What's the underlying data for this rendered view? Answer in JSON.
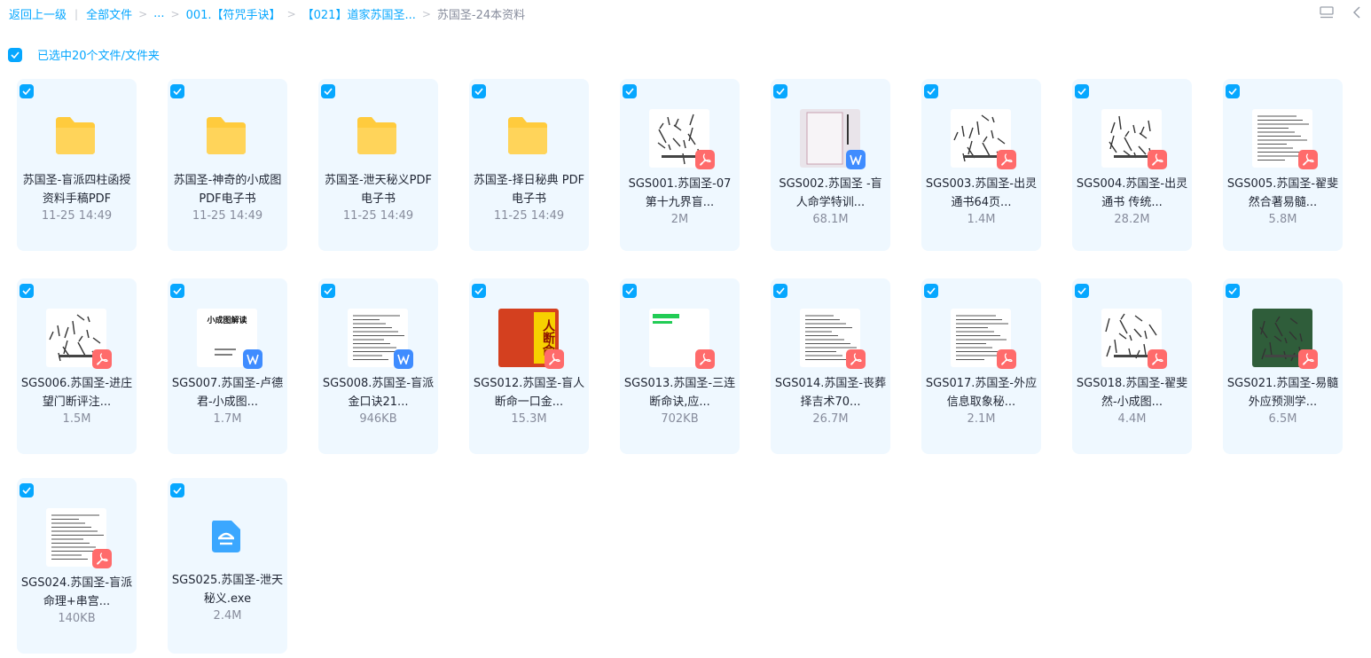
{
  "breadcrumb": {
    "back": "返回上一级",
    "items": [
      "全部文件",
      "...",
      "001.【符咒手诀】",
      "【021】道家苏国圣...",
      "苏国圣-24本资料"
    ]
  },
  "selection": {
    "label": "已选中20个文件/文件夹"
  },
  "icons": {
    "top_right": [
      "list-view-icon",
      "collapse-chevron-icon"
    ]
  },
  "files": [
    {
      "type": "folder",
      "name": "苏国圣-盲派四柱函授资料手稿PDF",
      "meta": "11-25 14:49"
    },
    {
      "type": "folder",
      "name": "苏国圣-神奇的小成图 PDF电子书",
      "meta": "11-25 14:49"
    },
    {
      "type": "folder",
      "name": "苏国圣-泄天秘义PDF电子书",
      "meta": "11-25 14:49"
    },
    {
      "type": "folder",
      "name": "苏国圣-择日秘典 PDF电子书",
      "meta": "11-25 14:49"
    },
    {
      "type": "pdf",
      "name": "SGS001.苏国圣-07第十九界盲...",
      "meta": "2M"
    },
    {
      "type": "word",
      "name": "SGS002.苏国圣 -盲人命学特训...",
      "meta": "68.1M"
    },
    {
      "type": "pdf",
      "name": "SGS003.苏国圣-出灵通书64页...",
      "meta": "1.4M"
    },
    {
      "type": "pdf",
      "name": "SGS004.苏国圣-出灵通书 传统...",
      "meta": "28.2M"
    },
    {
      "type": "pdf",
      "name": "SGS005.苏国圣-翟斐然合著易髓...",
      "meta": "5.8M"
    },
    {
      "type": "pdf",
      "name": "SGS006.苏国圣-进庄望门断评注...",
      "meta": "1.5M"
    },
    {
      "type": "word",
      "name": "SGS007.苏国圣-卢德君-小成图...",
      "meta": "1.7M",
      "thumb_text": "小成图解读"
    },
    {
      "type": "word",
      "name": "SGS008.苏国圣-盲派金口诀21...",
      "meta": "946KB"
    },
    {
      "type": "pdf",
      "name": "SGS012.苏国圣-盲人断命一口金...",
      "meta": "15.3M",
      "thumb_text": "人断命"
    },
    {
      "type": "pdf",
      "name": "SGS013.苏国圣-三连断命诀,应...",
      "meta": "702KB"
    },
    {
      "type": "pdf",
      "name": "SGS014.苏国圣-丧葬择吉术70...",
      "meta": "26.7M"
    },
    {
      "type": "pdf",
      "name": "SGS017.苏国圣-外应信息取象秘...",
      "meta": "2.1M"
    },
    {
      "type": "pdf",
      "name": "SGS018.苏国圣-翟斐然-小成图...",
      "meta": "4.4M"
    },
    {
      "type": "pdf",
      "name": "SGS021.苏国圣-易髓外应预测学...",
      "meta": "6.5M"
    },
    {
      "type": "pdf",
      "name": "SGS024.苏国圣-盲派命理+串宫...",
      "meta": "140KB"
    },
    {
      "type": "exe",
      "name": "SGS025.苏国圣-泄天秘义.exe",
      "meta": "2.4M"
    }
  ],
  "colors": {
    "accent": "#06a7ff",
    "card_bg": "#eff8ff",
    "pdf_badge": "#ff6b6b",
    "word_badge": "#3f8cff",
    "folder": "#ffcb3d"
  }
}
